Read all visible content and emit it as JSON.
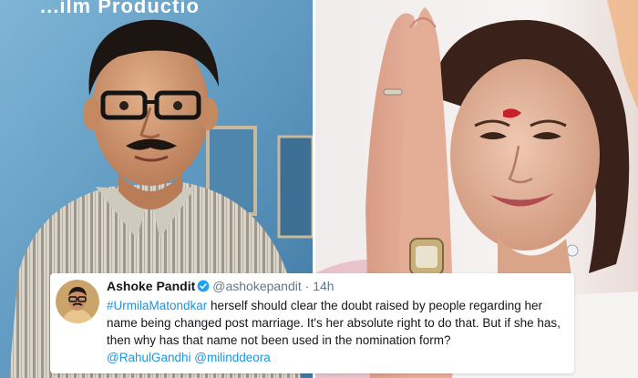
{
  "tweet": {
    "name": "Ashoke Pandit",
    "handle": "@ashokepandit",
    "separator": "·",
    "time": "14h",
    "hashtag": "#UrmilaMatondkar",
    "text": " herself should clear the doubt raised by people regarding her name being changed post marriage. It's her absolute right to do that. But if she has, then why has that name not been used in the nomination form?",
    "mention_1": "@RahulGandhi",
    "mention_2": "@milinddeora"
  },
  "left_photo": {
    "banner_text": "...ilm Productio"
  },
  "colors": {
    "link": "#1b95e0",
    "verified_badge": "#1da1f2",
    "name_text": "#14171a",
    "meta_text": "#657786"
  }
}
